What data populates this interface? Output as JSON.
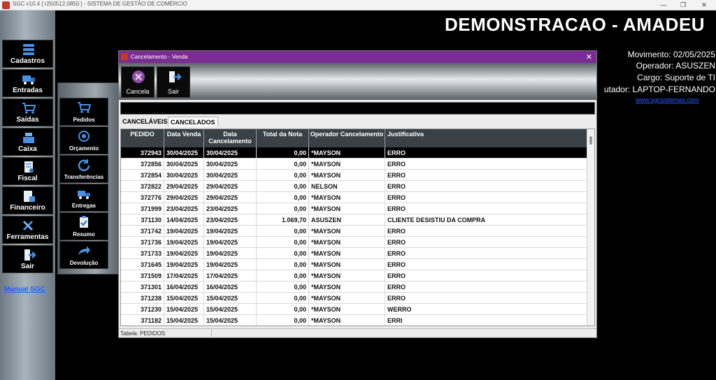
{
  "app": {
    "window_title": "SGC v10.4 [ r250512.0850 ] - SISTEMA DE GESTÃO DE COMÉRCIO",
    "minimize": "—",
    "maximize": "❐",
    "close": "✕"
  },
  "sidebar": {
    "items": [
      {
        "label": "Cadastros",
        "icon": "database-icon"
      },
      {
        "label": "Entradas",
        "icon": "truck-icon"
      },
      {
        "label": "Saídas",
        "icon": "cart-icon"
      },
      {
        "label": "Caixa",
        "icon": "cash-register-icon"
      },
      {
        "label": "Fiscal",
        "icon": "document-icon"
      },
      {
        "label": "Financeiro",
        "icon": "finance-icon"
      },
      {
        "label": "Ferramentas",
        "icon": "tools-icon"
      },
      {
        "label": "Sair",
        "icon": "exit-door-icon"
      }
    ],
    "manual_link": "Manual SGC"
  },
  "submenu": {
    "items": [
      {
        "label": "Pedidos",
        "icon": "cart-icon"
      },
      {
        "label": "Orçamento",
        "icon": "target-icon"
      },
      {
        "label": "Transferências",
        "icon": "refresh-icon"
      },
      {
        "label": "Entregas",
        "icon": "delivery-icon"
      },
      {
        "label": "Resumo",
        "icon": "clipboard-icon"
      },
      {
        "label": "Devolução",
        "icon": "return-arrow-icon"
      }
    ]
  },
  "header": {
    "brand": "DEMONSTRACAO - AMADEU",
    "movimento": "Movimento: 02/05/2025",
    "operador": "Operador: ASUSZEN",
    "cargo": "Cargo: Suporte de TI",
    "computador": "utador: LAPTOP-FERNANDO",
    "site": "www.sgcsistemas.com"
  },
  "dialog": {
    "title": "Cancelamento - Venda",
    "close": "✕",
    "toolbar": {
      "cancel_label": "Cancela",
      "exit_label": "Sair"
    },
    "tabs": [
      "CANCELÁVEIS",
      "CANCELADOS"
    ],
    "active_tab": "CANCELADOS",
    "columns": [
      "PEDIDO",
      "Data Venda",
      "Data Cancelamento",
      "Total da Nota",
      "Operador Cancelamento",
      "Justificativa"
    ],
    "rows": [
      [
        "372943",
        "30/04/2025",
        "30/04/2025",
        "0,00",
        "*MAYSON",
        "ERRO"
      ],
      [
        "372856",
        "30/04/2025",
        "30/04/2025",
        "0,00",
        "*MAYSON",
        "ERRO"
      ],
      [
        "372854",
        "30/04/2025",
        "30/04/2025",
        "0,00",
        "*MAYSON",
        "ERRO"
      ],
      [
        "372822",
        "29/04/2025",
        "29/04/2025",
        "0,00",
        "NELSON",
        "ERRO"
      ],
      [
        "372776",
        "29/04/2025",
        "29/04/2025",
        "0,00",
        "*MAYSON",
        "ERRO"
      ],
      [
        "371999",
        "23/04/2025",
        "23/04/2025",
        "0,00",
        "*MAYSON",
        "ERRO"
      ],
      [
        "371130",
        "14/04/2025",
        "23/04/2025",
        "1.069,70",
        "ASUSZEN",
        "CLIENTE DESISTIU DA COMPRA"
      ],
      [
        "371742",
        "19/04/2025",
        "19/04/2025",
        "0,00",
        "*MAYSON",
        "ERRO"
      ],
      [
        "371736",
        "19/04/2025",
        "19/04/2025",
        "0,00",
        "*MAYSON",
        "ERRO"
      ],
      [
        "371733",
        "19/04/2025",
        "19/04/2025",
        "0,00",
        "*MAYSON",
        "ERRO"
      ],
      [
        "371645",
        "19/04/2025",
        "19/04/2025",
        "0,00",
        "*MAYSON",
        "ERRO"
      ],
      [
        "371509",
        "17/04/2025",
        "17/04/2025",
        "0,00",
        "*MAYSON",
        "ERRO"
      ],
      [
        "371301",
        "16/04/2025",
        "16/04/2025",
        "0,00",
        "*MAYSON",
        "ERRO"
      ],
      [
        "371238",
        "15/04/2025",
        "15/04/2025",
        "0,00",
        "*MAYSON",
        "ERRO"
      ],
      [
        "371230",
        "15/04/2025",
        "15/04/2025",
        "0,00",
        "*MAYSON",
        "WERRO"
      ],
      [
        "371182",
        "15/04/2025",
        "15/04/2025",
        "0,00",
        "*MAYSON",
        "ERRI"
      ]
    ],
    "status": "Tabela: PEDIDOS"
  }
}
